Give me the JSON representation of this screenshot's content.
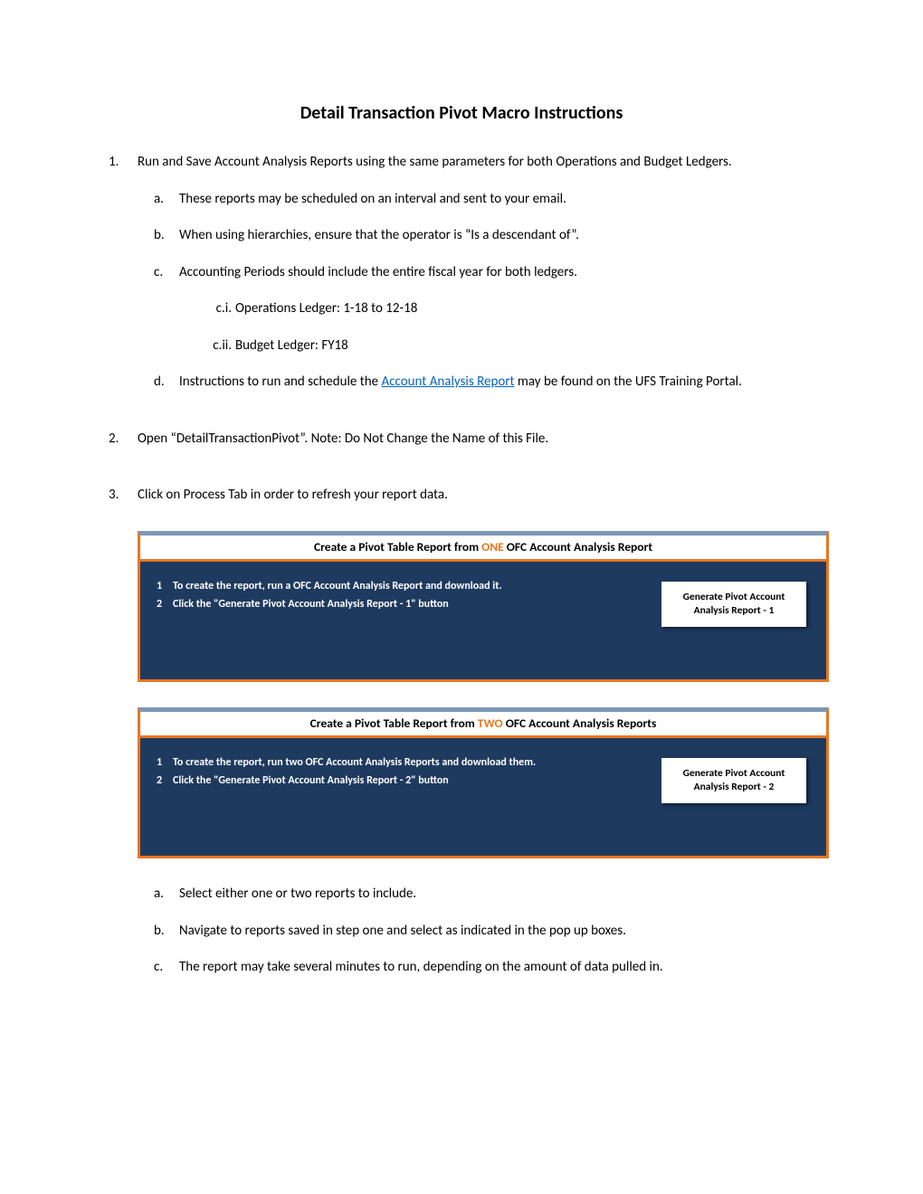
{
  "title": "Detail Transaction Pivot Macro Instructions",
  "step1": {
    "num": "1.",
    "text": "Run and Save Account Analysis Reports using the same parameters for both Operations and Budget Ledgers.",
    "a": {
      "mark": "a.",
      "text": "These reports may be scheduled on an interval and sent to your email."
    },
    "b": {
      "mark": "b.",
      "text": "When using hierarchies, ensure that the operator is “Is a descendant of”."
    },
    "c": {
      "mark": "c.",
      "text": "Accounting Periods should include the entire fiscal year for both ledgers.",
      "i": {
        "mark": "c.i.",
        "text": "Operations Ledger: 1-18 to 12-18"
      },
      "ii": {
        "mark": "c.ii.",
        "text": "Budget Ledger: FY18"
      }
    },
    "d": {
      "mark": "d.",
      "pre": "Instructions to run and schedule the ",
      "link": "Account Analysis Report",
      "post": " may be found on the UFS Training Portal."
    }
  },
  "step2": {
    "num": "2.",
    "text": "Open “DetailTransactionPivot”. Note: Do Not Change the Name of this File."
  },
  "step3": {
    "num": "3.",
    "text": "Click on Process Tab in order to refresh your report data.",
    "a": {
      "mark": "a.",
      "text": "Select either one or two reports to include."
    },
    "b": {
      "mark": "b.",
      "text": "Navigate to reports saved in step one and select as indicated in the pop up boxes."
    },
    "c": {
      "mark": "c.",
      "text": "The report may take several minutes to run, depending on the amount of data pulled in."
    }
  },
  "panel1": {
    "header_pre": "Create a Pivot Table Report from ",
    "header_hl": "ONE",
    "header_post": " OFC Account Analysis Report",
    "row1": {
      "num": "1",
      "text": "To create the report, run a OFC Account Analysis Report and download it."
    },
    "row2": {
      "num": "2",
      "text": "Click the \"Generate Pivot Account Analysis Report - 1\" button"
    },
    "button": "Generate Pivot Account Analysis Report - 1"
  },
  "panel2": {
    "header_pre": "Create a Pivot Table Report from ",
    "header_hl": "TWO",
    "header_post": " OFC Account Analysis Reports",
    "row1": {
      "num": "1",
      "text": "To create the report, run two OFC Account Analysis Reports and download them."
    },
    "row2": {
      "num": "2",
      "text": "Click the \"Generate Pivot Account Analysis Report - 2\" button"
    },
    "button": "Generate Pivot Account Analysis Report - 2"
  }
}
